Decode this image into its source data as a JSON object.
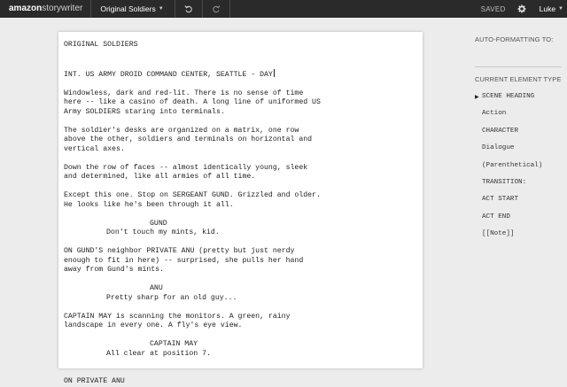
{
  "topbar": {
    "logo_bold": "amazon",
    "logo_light": "storywriter",
    "doc_title": "Original Soldiers",
    "status": "SAVED",
    "user": "Luke",
    "icons": {
      "title_caret": "chevron-down-icon",
      "undo": "undo-icon",
      "redo": "redo-icon",
      "settings": "gear-icon",
      "user_caret": "chevron-down-icon"
    }
  },
  "script": {
    "title": "ORIGINAL SOLDIERS",
    "scene_heading": "INT. US ARMY DROID COMMAND CENTER, SEATTLE - DAY",
    "action_1": "Windowless, dark and red-lit. There is no sense of time\nhere -- like a casino of death. A long line of uniformed US\nArmy SOLDIERS staring into terminals.",
    "action_2": "The soldier's desks are organized on a matrix, one row\nabove the other, soldiers and terminals on horizontal and\nvertical axes.",
    "action_3": "Down the row of faces -- almost identically young, sleek\nand determined, like all armies of all time.",
    "action_4": "Except this one. Stop on SERGEANT GUND. Grizzled and older.\nHe looks like he's been through it all.",
    "char_1": "GUND",
    "dial_1": "Don't touch my mints, kid.",
    "action_5": "ON GUND'S neighbor PRIVATE ANU (pretty but just nerdy\nenough to fit in here) -- surprised, she pulls her hand\naway from Gund's mints.",
    "char_2": "ANU",
    "dial_2": "Pretty sharp for an old guy...",
    "action_6": "CAPTAIN MAY is scanning the monitors. A green, rainy\nlandscape in every one. A fly's eye view.",
    "char_3": "CAPTAIN MAY",
    "dial_3": "All clear at position 7.",
    "scene_2": "ON PRIVATE ANU"
  },
  "panel": {
    "autoformat_label": "AUTO-FORMATTING TO:",
    "current_label": "CURRENT ELEMENT TYPE",
    "elements": [
      "SCENE HEADING",
      "Action",
      "CHARACTER",
      "Dialogue",
      "(Parenthetical)",
      "TRANSITION:",
      "ACT START",
      "ACT END",
      "[[Note]]"
    ],
    "selected_index": 0
  }
}
